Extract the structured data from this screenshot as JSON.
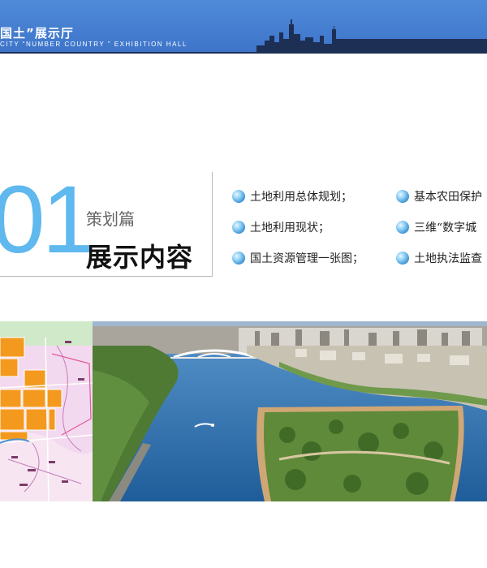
{
  "header": {
    "title": "国土”展示厅",
    "subtitle": "CITY  “NUMBER  COUNTRY ”  EXHIBITION  HALL"
  },
  "section": {
    "number": "01",
    "subtitle": "策划篇",
    "title": "展示内容"
  },
  "items": [
    {
      "label": "土地利用总体规划；",
      "icon": "blue-sphere-bullet"
    },
    {
      "label": "土地利用现状；",
      "icon": "blue-sphere-bullet"
    },
    {
      "label": "国土资源管理一张图；",
      "icon": "blue-sphere-bullet"
    },
    {
      "label": "基本农田保护",
      "icon": "blue-sphere-bullet"
    },
    {
      "label": "三维“数字城",
      "icon": "blue-sphere-bullet"
    },
    {
      "label": "土地执法监查",
      "icon": "blue-sphere-bullet"
    }
  ],
  "colors": {
    "header_blue": "#4f8ad8",
    "accent_blue": "#5fb8ee",
    "map_orange": "#f39a1e",
    "river_blue": "#2f6fb0"
  }
}
